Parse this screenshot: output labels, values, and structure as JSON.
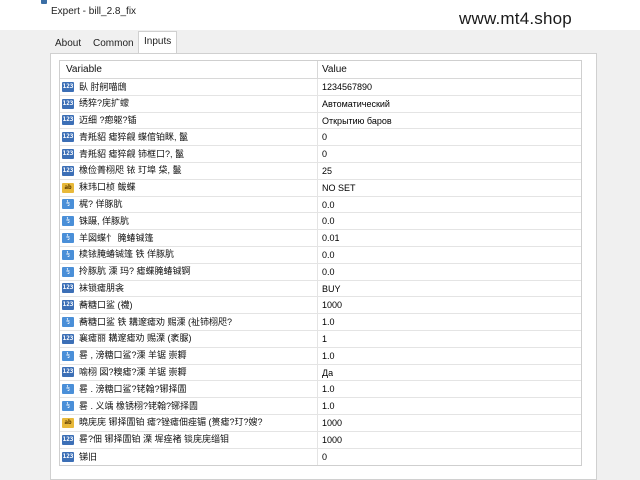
{
  "window": {
    "title": "Expert - bill_2.8_fix",
    "watermark": "www.mt4.shop"
  },
  "tabs": [
    {
      "label": "About",
      "active": false
    },
    {
      "label": "Common",
      "active": false
    },
    {
      "label": "Inputs",
      "active": true
    }
  ],
  "table": {
    "headers": {
      "variable": "Variable",
      "value": "Value"
    },
    "rows": [
      {
        "type": "int-icon",
        "name": "臥    肘舸喵鴟",
        "value": "1234567890"
      },
      {
        "type": "int-icon",
        "name": "绣猝?庑扩蠓",
        "value": "Автоматический"
      },
      {
        "type": "int-icon",
        "name": "迈细 ?瘛躯?锸",
        "value": "Открытию баров"
      },
      {
        "type": "int-icon",
        "name": "青羝貂 瘧猝觎 蝶倌铂眯, 鬣",
        "value": "0"
      },
      {
        "type": "int-icon",
        "name": "青羝貂 瘧猝觎 铈框口?, 鬣",
        "value": "0"
      },
      {
        "type": "int-icon",
        "name": "橡俭菁栩咫   铱 玎埠   柋, 鬣",
        "value": "25"
      },
      {
        "type": "str-icon",
        "name": "秣玮口桢  鲅蝶",
        "value": "NO SET"
      },
      {
        "type": "dbl-icon",
        "name": "梶? 佯豚肮",
        "value": "0.0"
      },
      {
        "type": "dbl-icon",
        "name": "铢蹑, 佯豚肮",
        "value": "0.0"
      },
      {
        "type": "dbl-icon",
        "name": "羊図蝶忄      腌蝽铖篷",
        "value": "0.01"
      },
      {
        "type": "dbl-icon",
        "name": "椟铱腌蝽铖篷  铁 佯豚肮",
        "value": "0.0"
      },
      {
        "type": "dbl-icon",
        "name": "拎豚肮  溧    玛?  瘧蝶腌蝽铖锕",
        "value": "0.0"
      },
      {
        "type": "int-icon",
        "name": "袜锁瘧朋衾",
        "value": "BUY"
      },
      {
        "type": "int-icon",
        "name": "蕎糖口鲨     (襪)",
        "value": "1000"
      },
      {
        "type": "dbl-icon",
        "name": "蕎糖口鲨     铁  耩邃瘧劝  赐溧 (祉铈栩咫?",
        "value": "1.0"
      },
      {
        "type": "int-icon",
        "name": "襄瘧丽 耩邃瘧劝  赐溧 (袤脲)",
        "value": "1"
      },
      {
        "type": "dbl-icon",
        "name": "晷   , 滂糖口鲨?溧    羊锯  崇耨",
        "value": "1.0"
      },
      {
        "type": "int-icon",
        "name": "喻栩   図?糗瘧?溧    羊锯  崇耨",
        "value": "Да"
      },
      {
        "type": "dbl-icon",
        "name": "晷  . 滂糖口鲨?铑翰?铘择圊",
        "value": "1.0"
      },
      {
        "type": "dbl-icon",
        "name": "晷   . 义竬  橡锈栩?铑翰?铘择圊",
        "value": "1.0"
      },
      {
        "type": "str-icon",
        "name": "曉庑庑  铘择圊铂 瘧?锉瘧佃痤镅  (篑瘧?玎?嫂?",
        "value": "1000"
      },
      {
        "type": "int-icon",
        "name": "晷?佃  铘择圊铂  溧      墀痤褚  锬庑庑缁钼",
        "value": "1000"
      },
      {
        "type": "int-icon",
        "name": "锑旧",
        "value": "0"
      }
    ]
  },
  "type_labels": {
    "int-icon": "123",
    "dbl-icon": "½",
    "str-icon": "ab"
  }
}
